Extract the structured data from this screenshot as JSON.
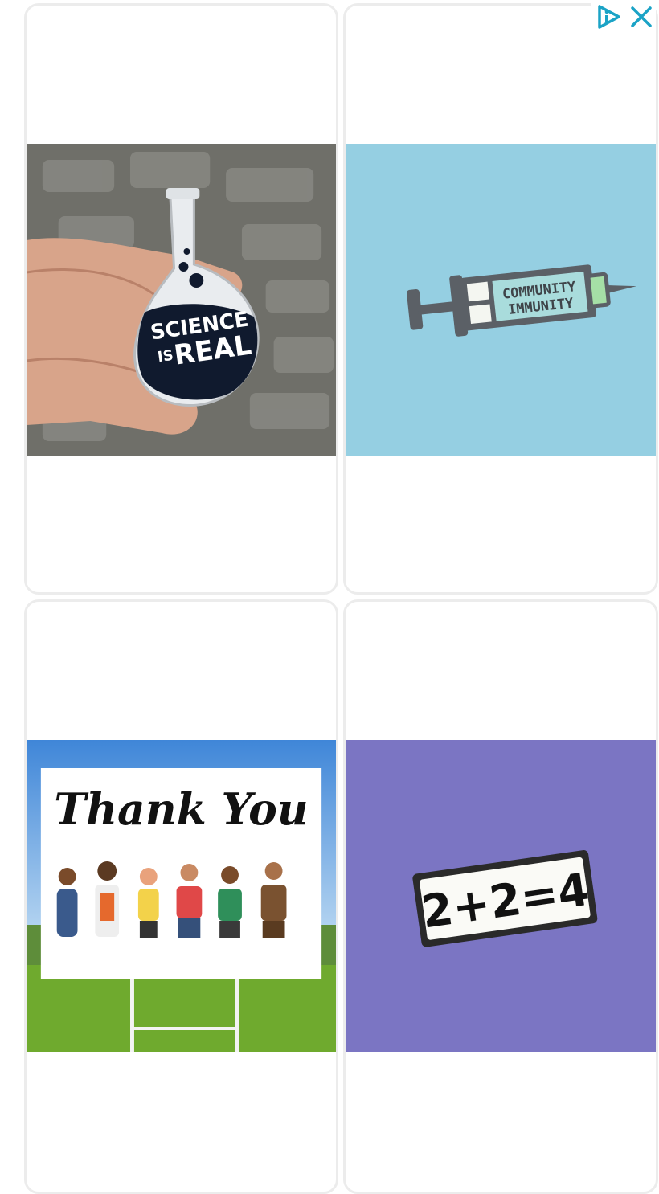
{
  "ad_controls": {
    "info_icon": "adchoices-icon",
    "close_icon": "close-icon",
    "accent": "#1ba3c6"
  },
  "products": [
    {
      "image": "science-is-real-flask-pin-photo",
      "text": [
        "SCIENCE",
        "IS",
        "REAL"
      ]
    },
    {
      "image": "community-immunity-syringe-pin-photo",
      "text": [
        "COMMUNITY",
        "IMMUNITY"
      ]
    },
    {
      "image": "thank-you-essential-workers-yard-sign-photo",
      "text": [
        "Thank You"
      ]
    },
    {
      "image": "2-plus-2-equals-4-pin-photo",
      "text": [
        "2+2=4"
      ]
    }
  ]
}
